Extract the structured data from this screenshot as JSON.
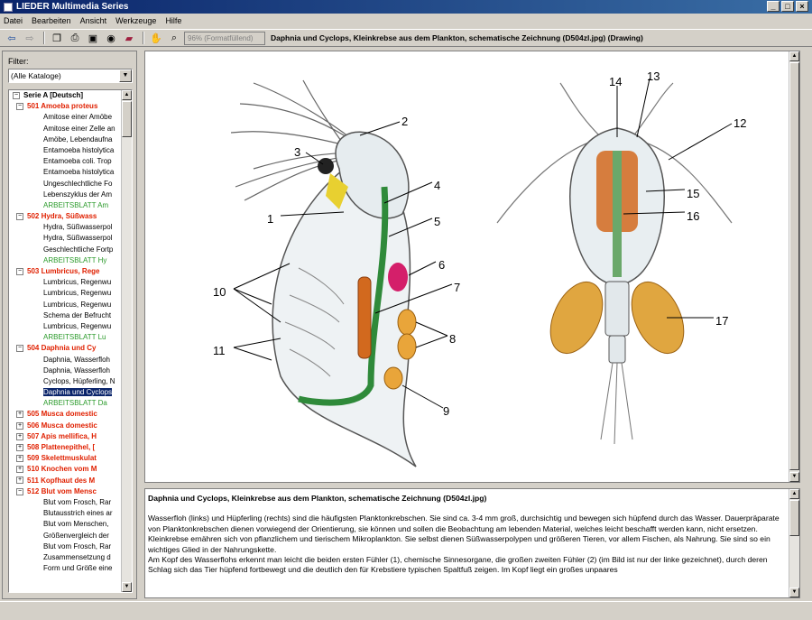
{
  "window": {
    "title": "LIEDER Multimedia Series",
    "controls": [
      "_",
      "□",
      "×"
    ]
  },
  "menu": [
    "Datei",
    "Bearbeiten",
    "Ansicht",
    "Werkzeuge",
    "Hilfe"
  ],
  "toolbar": {
    "zoom": "96% (Formatfüllend)",
    "caption": "Daphnia und Cyclops, Kleinkrebse aus dem Plankton, schematische Zeichnung  (D504zl.jpg) (Drawing)"
  },
  "filter": {
    "label": "Filter:",
    "value": "(Alle Kataloge)"
  },
  "tree": [
    {
      "level": "root",
      "text": "Serie A [Deutsch]",
      "toggle": "−"
    },
    {
      "level": "l1",
      "text": "501  Amoeba proteus",
      "toggle": "−"
    },
    {
      "level": "l2",
      "text": "Amitose einer Amöbe"
    },
    {
      "level": "l2",
      "text": "Amitose einer Zelle an"
    },
    {
      "level": "l2",
      "text": "Amöbe, Lebendaufna"
    },
    {
      "level": "l2",
      "text": "Entamoeba histolytica"
    },
    {
      "level": "l2",
      "text": "Entamoeba coli. Trop"
    },
    {
      "level": "l2",
      "text": "Entamoeba histolytica"
    },
    {
      "level": "l2",
      "text": "Ungeschlechtliche Fo"
    },
    {
      "level": "l2",
      "text": "Lebenszyklus der Am"
    },
    {
      "level": "l2",
      "text": "ARBEITSBLATT Am",
      "sheet": true
    },
    {
      "level": "l1",
      "text": "502  Hydra, Süßwass",
      "toggle": "−"
    },
    {
      "level": "l2",
      "text": "Hydra, Süßwasserpol"
    },
    {
      "level": "l2",
      "text": "Hydra, Süßwasserpol"
    },
    {
      "level": "l2",
      "text": "Geschlechtliche Fortp"
    },
    {
      "level": "l2",
      "text": "ARBEITSBLATT Hy",
      "sheet": true
    },
    {
      "level": "l1",
      "text": "503  Lumbricus, Rege",
      "toggle": "−"
    },
    {
      "level": "l2",
      "text": "Lumbricus, Regenwu"
    },
    {
      "level": "l2",
      "text": "Lumbricus, Regenwu"
    },
    {
      "level": "l2",
      "text": "Lumbricus, Regenwu"
    },
    {
      "level": "l2",
      "text": "Schema der Befrucht"
    },
    {
      "level": "l2",
      "text": "Lumbricus, Regenwu"
    },
    {
      "level": "l2",
      "text": "ARBEITSBLATT Lu",
      "sheet": true
    },
    {
      "level": "l1",
      "text": "504  Daphnia und Cy",
      "toggle": "−"
    },
    {
      "level": "l2",
      "text": "Daphnia, Wasserfloh"
    },
    {
      "level": "l2",
      "text": "Daphnia, Wasserfloh"
    },
    {
      "level": "l2",
      "text": "Cyclops, Hüpferling, N"
    },
    {
      "level": "l2",
      "text": "Daphnia und Cyclops",
      "selected": true
    },
    {
      "level": "l2",
      "text": "ARBEITSBLATT Da",
      "sheet": true
    },
    {
      "level": "l1",
      "text": "505  Musca domestic",
      "toggle": "+"
    },
    {
      "level": "l1",
      "text": "506  Musca domestic",
      "toggle": "+"
    },
    {
      "level": "l1",
      "text": "507  Apis mellifica, H",
      "toggle": "+"
    },
    {
      "level": "l1",
      "text": "508  Plattenepithel, [",
      "toggle": "+"
    },
    {
      "level": "l1",
      "text": "509  Skelettmuskulat",
      "toggle": "+"
    },
    {
      "level": "l1",
      "text": "510  Knochen vom M",
      "toggle": "+"
    },
    {
      "level": "l1",
      "text": "511  Kopfhaut des M",
      "toggle": "+"
    },
    {
      "level": "l1",
      "text": "512  Blut vom Mensc",
      "toggle": "−"
    },
    {
      "level": "l2",
      "text": "Blut vom Frosch, Rar"
    },
    {
      "level": "l2",
      "text": "Blutausstrich eines ar"
    },
    {
      "level": "l2",
      "text": "Blut vom Menschen,"
    },
    {
      "level": "l2",
      "text": "Größenvergleich der"
    },
    {
      "level": "l2",
      "text": "Blut vom Frosch, Rar"
    },
    {
      "level": "l2",
      "text": "Zusammensetzung d"
    },
    {
      "level": "l2",
      "text": "Form und Größe eine"
    }
  ],
  "drawing": {
    "labels": [
      "1",
      "2",
      "3",
      "4",
      "5",
      "6",
      "7",
      "8",
      "9",
      "10",
      "11",
      "12",
      "13",
      "14",
      "15",
      "16",
      "17"
    ]
  },
  "description": {
    "heading": "Daphnia und Cyclops, Kleinkrebse aus dem Plankton, schematische Zeichnung  (D504zl.jpg)",
    "p1": "Wasserfloh (links) und Hüpferling (rechts) sind die häufigsten Planktonkrebschen. Sie sind ca. 3-4 mm groß, durchsichtig und bewegen sich hüpfend durch das Wasser. Dauerpräparate von Planktonkrebschen dienen vorwiegend der Orientierung, sie können und sollen die Beobachtung am lebenden Material, welches leicht beschafft werden kann, nicht ersetzen.",
    "p2": "Kleinkrebse ernähren sich von pflanzlichem und tierischem Mikroplankton. Sie selbst dienen Süßwasserpolypen und größeren Tieren, vor allem Fischen, als Nahrung. Sie sind so ein wichtiges Glied in der Nahrungskette.",
    "p3": "Am Kopf des Wasserflohs erkennt man leicht die beiden ersten Fühler (1), chemische Sinnesorgane, die großen zweiten Fühler (2) (im Bild ist nur der linke gezeichnet), durch deren Schlag sich das Tier hüpfend fortbewegt und die deutlich den für Krebstiere typischen Spaltfuß zeigen. Im Kopf liegt ein großes unpaares"
  }
}
